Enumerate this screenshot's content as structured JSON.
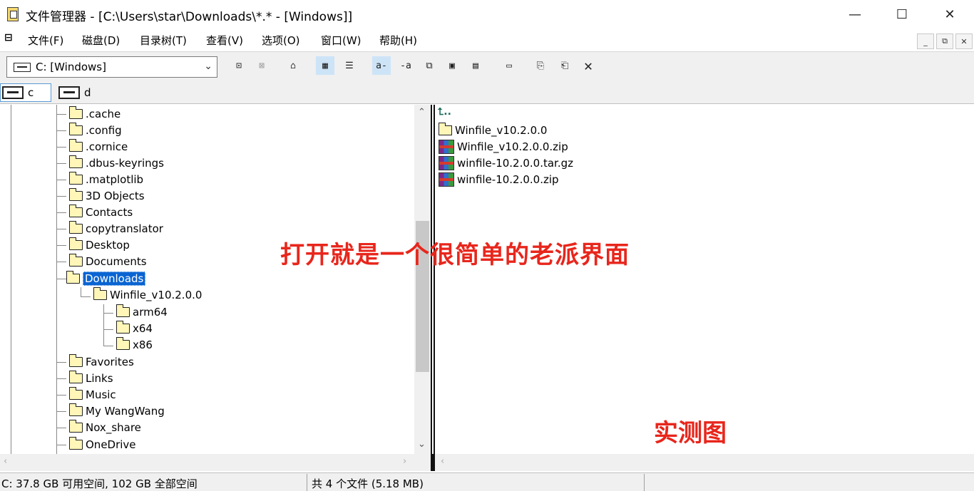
{
  "window": {
    "title": "文件管理器 - [C:\\Users\\star\\Downloads\\*.* - [Windows]]",
    "minimize_glyph": "—",
    "maximize_glyph": "☐",
    "close_glyph": "✕"
  },
  "menubar": {
    "system_icon": "cascade-icon",
    "items": [
      "文件(F)",
      "磁盘(D)",
      "目录树(T)",
      "查看(V)",
      "选项(O)",
      "窗口(W)",
      "帮助(H)"
    ],
    "mdi_minimize": "_",
    "mdi_restore": "⧉",
    "mdi_close": "✕"
  },
  "toolbar": {
    "drive_select_value": "C: [Windows]",
    "buttons": [
      {
        "icon": "connect-network-drive-icon",
        "glyph": "⊡"
      },
      {
        "icon": "disconnect-network-drive-icon",
        "glyph": "⊠"
      },
      {
        "icon": "share-icon",
        "glyph": "⌂"
      },
      {
        "icon": "large-icons-view-icon",
        "glyph": "▦"
      },
      {
        "icon": "list-view-icon",
        "glyph": "☰"
      },
      {
        "icon": "sort-by-name-icon",
        "glyph": "a-"
      },
      {
        "icon": "sort-by-type-icon",
        "glyph": "-a"
      },
      {
        "icon": "new-window-icon",
        "glyph": "⧉"
      },
      {
        "icon": "date-sort-icon",
        "glyph": "▣"
      },
      {
        "icon": "size-sort-icon",
        "glyph": "▤"
      },
      {
        "icon": "network-icon",
        "glyph": "▭"
      },
      {
        "icon": "copy-icon",
        "glyph": "⎘"
      },
      {
        "icon": "paste-icon",
        "glyph": "⎗"
      },
      {
        "icon": "delete-icon",
        "glyph": "✕"
      }
    ]
  },
  "drives": [
    {
      "letter": "c",
      "icon": "hard-drive-icon"
    },
    {
      "letter": "d",
      "icon": "hard-drive-icon"
    }
  ],
  "tree": {
    "top_level": [
      ".cache",
      ".config",
      ".cornice",
      ".dbus-keyrings",
      ".matplotlib",
      "3D Objects",
      "Contacts",
      "copytranslator",
      "Desktop",
      "Documents",
      "Downloads",
      "Favorites",
      "Links",
      "Music",
      "My WangWang",
      "Nox_share",
      "OneDrive"
    ],
    "selected": "Downloads",
    "downloads_child": "Winfile_v10.2.0.0",
    "winfile_children": [
      "arm64",
      "x64",
      "x86"
    ]
  },
  "files": {
    "up_label": "⮤..",
    "items": [
      {
        "name": "Winfile_v10.2.0.0",
        "type": "folder"
      },
      {
        "name": "Winfile_v10.2.0.0.zip",
        "type": "archive"
      },
      {
        "name": "winfile-10.2.0.0.tar.gz",
        "type": "archive"
      },
      {
        "name": "winfile-10.2.0.0.zip",
        "type": "archive"
      }
    ]
  },
  "overlay": {
    "caption": "打开就是一个很简单的老派界面",
    "badge": "实测图",
    "color": "#e8261c"
  },
  "status": {
    "disk_space": "C: 37.8 GB 可用空间, 102 GB 全部空间",
    "file_count": "共 4 个文件 (5.18 MB)"
  }
}
